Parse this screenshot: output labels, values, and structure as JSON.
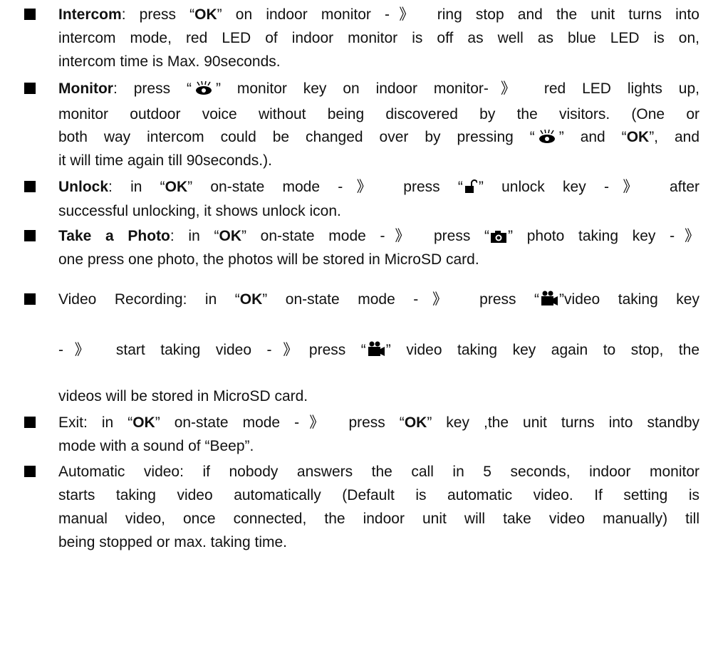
{
  "items": [
    {
      "title": "Intercom",
      "lines": [
        {
          "pre": ": press “",
          "ok": "OK",
          "post": "” on indoor monitor -》 ring stop and the unit turns into"
        },
        {
          "text": "intercom mode, red LED of indoor monitor is off as well as blue LED is on,"
        },
        {
          "text": "intercom time is Max. 90seconds."
        }
      ]
    },
    {
      "title": "Monitor",
      "lines": [
        {
          "pre": ": press “",
          "icon": "monitor-eye-icon",
          "post": "”  monitor key on indoor monitor-》 red LED lights up,"
        },
        {
          "text": "monitor outdoor voice without being discovered by the visitors. (One or"
        },
        {
          "pre": "both way intercom could be changed over by pressing “",
          "icon": "monitor-eye-icon",
          "mid": "” and “",
          "ok": "OK",
          "post": "”, and"
        },
        {
          "text": "it will time again till 90seconds.)."
        }
      ]
    },
    {
      "title": "Unlock",
      "lines": [
        {
          "pre": ": in “",
          "ok": "OK",
          "mid": "” on-state mode -》  press “",
          "icon": "unlock-icon",
          "post": "” unlock key  -》  after"
        },
        {
          "text": "successful unlocking, it shows unlock icon."
        }
      ]
    },
    {
      "title": "Take a Photo",
      "lines": [
        {
          "pre": ": in “",
          "ok": "OK",
          "mid": "” on-state mode -》  press “",
          "icon": "camera-icon",
          "post": "” photo taking key -》"
        },
        {
          "text": "one press one photo, the photos will be stored in MicroSD card."
        }
      ]
    },
    {
      "title": "",
      "lines": [
        {
          "pre": "Video Recording: in “",
          "ok": "OK",
          "mid": "” on-state mode -》  press “",
          "icon": "video-camera-icon",
          "post": "”video taking key"
        },
        {
          "pre": "-》  start taking video  -》press “",
          "icon": "video-camera-icon",
          "post": "” video taking key again to stop, the"
        },
        {
          "text": "videos will be stored in MicroSD card."
        }
      ]
    },
    {
      "title": "",
      "lines": [
        {
          "pre": "Exit: in “",
          "ok": "OK",
          "mid": "” on-state mode -》  press “",
          "ok2": "OK",
          "post": "” key ,the unit turns into standby"
        },
        {
          "text": "mode with a sound of “Beep”."
        }
      ]
    },
    {
      "title": "",
      "lines": [
        {
          "text": "Automatic video: if nobody answers the call in 5 seconds, indoor monitor"
        },
        {
          "text": "starts taking video automatically (Default is automatic video. If setting is"
        },
        {
          "text": "manual video, once connected, the indoor unit will take video manually) till"
        },
        {
          "text": "being stopped or max. taking time."
        }
      ]
    }
  ]
}
